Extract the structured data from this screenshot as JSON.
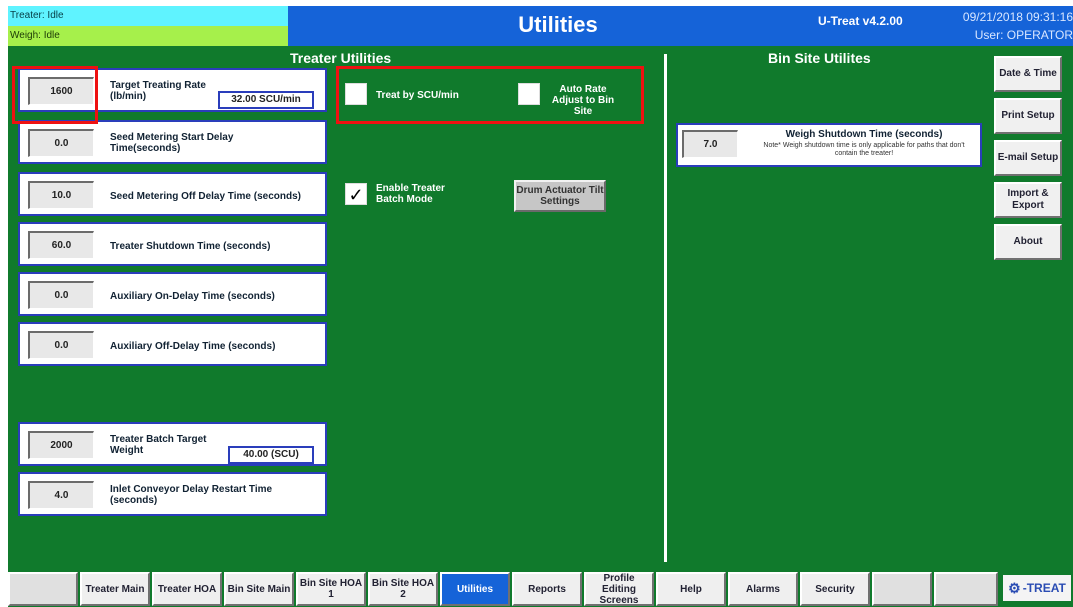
{
  "header": {
    "treater_status": "Treater: Idle",
    "weigh_status": "Weigh: Idle",
    "title": "Utilities",
    "version": "U-Treat v4.2.00",
    "datetime": "09/21/2018 09:31:16",
    "user": "User: OPERATOR"
  },
  "treater_utilities": {
    "title": "Treater Utilities",
    "rows": [
      {
        "value": "1600",
        "label": "Target Treating Rate (lb/min)",
        "unit": "32.00  SCU/min"
      },
      {
        "value": "0.0",
        "label": "Seed Metering Start Delay Time(seconds)"
      },
      {
        "value": "10.0",
        "label": "Seed Metering Off Delay Time (seconds)"
      },
      {
        "value": "60.0",
        "label": "Treater Shutdown Time (seconds)"
      },
      {
        "value": "0.0",
        "label": "Auxiliary On-Delay Time (seconds)"
      },
      {
        "value": "0.0",
        "label": "Auxiliary Off-Delay Time (seconds)"
      },
      {
        "value": "2000",
        "label": "Treater Batch Target Weight",
        "unit": "40.00  (SCU)"
      },
      {
        "value": "4.0",
        "label": "Inlet Conveyor Delay Restart Time (seconds)"
      }
    ],
    "treat_by_scu": {
      "label": "Treat by SCU/min",
      "checked": false
    },
    "auto_rate_adjust": {
      "label": "Auto Rate Adjust to Bin Site",
      "checked": false
    },
    "enable_batch_mode": {
      "label": "Enable Treater Batch Mode",
      "checked": true,
      "mark": "✓"
    },
    "drum_actuator_button": "Drum Actuator Tilt Settings"
  },
  "bin_site_utilities": {
    "title": "Bin Site Utilites",
    "weigh_shutdown": {
      "value": "7.0",
      "label": "Weigh Shutdown Time (seconds)",
      "note": "Note* Weigh shutdown time is only applicable for paths that don't contain the treater!"
    }
  },
  "side_buttons": [
    "Date & Time",
    "Print Setup",
    "E-mail Setup",
    "Import & Export",
    "About"
  ],
  "nav": [
    {
      "label": "Treater Main"
    },
    {
      "label": "Treater HOA"
    },
    {
      "label": "Bin Site Main"
    },
    {
      "label": "Bin Site HOA 1"
    },
    {
      "label": "Bin Site HOA 2"
    },
    {
      "label": "Utilities"
    },
    {
      "label": "Reports"
    },
    {
      "label": "Profile Editing Screens"
    },
    {
      "label": "Help"
    },
    {
      "label": "Alarms"
    },
    {
      "label": "Security"
    }
  ],
  "logo": {
    "text": "-TREAT",
    "icon": "gear-icon"
  },
  "colors": {
    "background": "#107a2c",
    "header": "#1563d8",
    "treater_status": "#5ff3ff",
    "weigh_status": "#a6f04b",
    "highlight": "#ee1111",
    "row_border": "#2a3dbb"
  }
}
